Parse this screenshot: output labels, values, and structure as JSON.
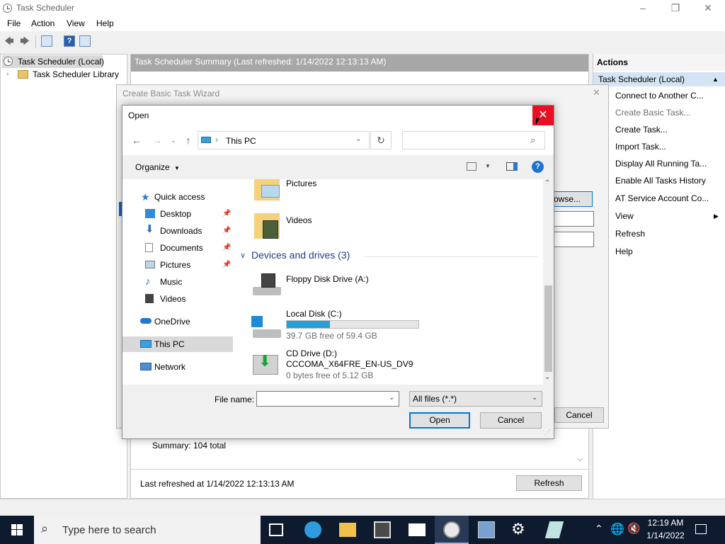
{
  "app": {
    "title": "Task Scheduler",
    "menu": [
      "File",
      "Action",
      "View",
      "Help"
    ]
  },
  "tree": {
    "items": [
      "Task Scheduler (Local)",
      "Task Scheduler Library"
    ]
  },
  "summary": {
    "header": "Task Scheduler Summary (Last refreshed: 1/14/2022 12:13:13 AM)",
    "total": "Summary: 104 total",
    "last_refreshed": "Last refreshed at 1/14/2022 12:13:13 AM",
    "refresh_button": "Refresh"
  },
  "actions": {
    "title": "Actions",
    "selected": "Task Scheduler (Local)",
    "items": [
      "Connect to Another C...",
      "Create Basic Task...",
      "Create Task...",
      "Import Task...",
      "Display All Running Ta...",
      "Enable All Tasks History",
      "AT Service Account Co...",
      "View",
      "Refresh",
      "Help"
    ]
  },
  "wizard": {
    "title": "Create Basic Task Wizard",
    "browse_button": "owse...",
    "cancel_button": "Cancel"
  },
  "open_dialog": {
    "title": "Open",
    "address": "This PC",
    "search_placeholder": "",
    "organize": "Organize",
    "nav": {
      "quick_access": "Quick access",
      "desktop": "Desktop",
      "downloads": "Downloads",
      "documents": "Documents",
      "pictures": "Pictures",
      "music": "Music",
      "videos": "Videos",
      "onedrive": "OneDrive",
      "this_pc": "This PC",
      "network": "Network"
    },
    "folders": [
      "Pictures",
      "Videos"
    ],
    "devices_header": "Devices and drives (3)",
    "drives": {
      "floppy": {
        "name": "Floppy Disk Drive (A:)"
      },
      "local": {
        "name": "Local Disk (C:)",
        "free": "39.7 GB free of 59.4 GB",
        "used_fraction": 0.33
      },
      "cd": {
        "name": "CD Drive (D:)",
        "label": "CCCOMA_X64FRE_EN-US_DV9",
        "free": "0 bytes free of 5.12 GB"
      }
    },
    "file_name_label": "File name:",
    "file_name_value": "",
    "file_type": "All files (*.*)",
    "open_button": "Open",
    "cancel_button": "Cancel"
  },
  "taskbar": {
    "search_placeholder": "Type here to search",
    "time": "12:19 AM",
    "date": "1/14/2022"
  },
  "colors": {
    "accent": "#0078d7",
    "close_red": "#e81123",
    "taskbar": "#0e1a2e",
    "drive_bar": "#26a0da"
  }
}
